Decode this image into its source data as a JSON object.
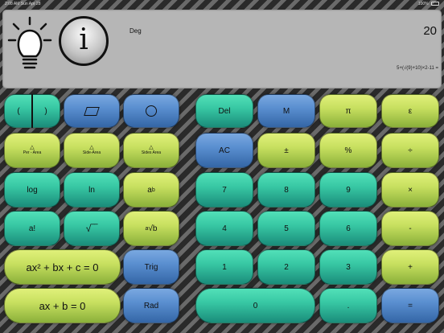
{
  "status": {
    "time": "2:08 AM",
    "date": "Sun Apr 28",
    "battery": "100%"
  },
  "display": {
    "mode": "Deg",
    "result": "20",
    "expression": "5+(√(9)+10)×2-11 ="
  },
  "icons": {
    "bulb": "lightbulb-icon",
    "info": "info-icon"
  },
  "info_glyph": "i",
  "keys": {
    "paren_open": "(",
    "paren_close": ")",
    "per_area": "Per - Area",
    "side_area": "Side-Area",
    "sides_area": "Sides Area",
    "triangle": "△",
    "log": "log",
    "ln": "ln",
    "pow_a": "a",
    "pow_b": "b",
    "fact": "a!",
    "sqrt": "√‾‾",
    "root_a": "a",
    "root_b": "√b",
    "quad": "ax² + bx + c = 0",
    "linear": "ax + b = 0",
    "trig": "Trig",
    "rad": "Rad",
    "del": "Del",
    "m": "M",
    "pi": "π",
    "eps": "ε",
    "ac": "AC",
    "pm": "±",
    "pct": "%",
    "div": "÷",
    "n7": "7",
    "n8": "8",
    "n9": "9",
    "mul": "×",
    "n4": "4",
    "n5": "5",
    "n6": "6",
    "minus": "-",
    "n1": "1",
    "n2": "2",
    "n3": "3",
    "plus": "+",
    "n0": "0",
    "dot": ".",
    "eq": "="
  },
  "colors": {
    "teal": "#38c8a4",
    "blue": "#5a8fd0",
    "lime": "#c8e060",
    "display": "#b6b6b6"
  }
}
